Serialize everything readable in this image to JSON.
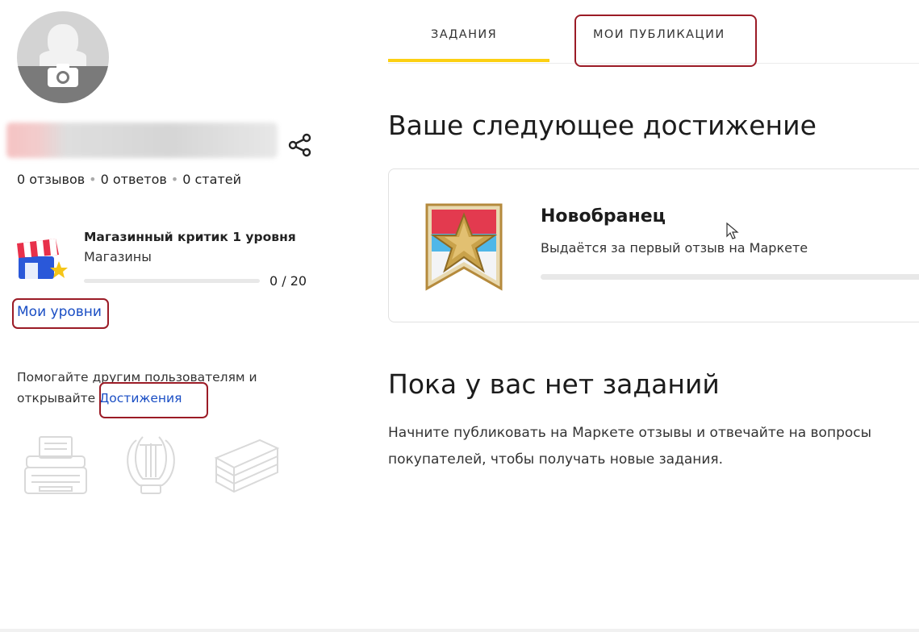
{
  "profile": {
    "stats": {
      "reviews": "0 отзывов",
      "answers": "0 ответов",
      "articles": "0 статей",
      "separator": "•"
    }
  },
  "level": {
    "title": "Магазинный критик 1 уровня",
    "category": "Магазины",
    "progress": 0,
    "progress_text": "0 / 20"
  },
  "links": {
    "my_levels": "Мои уровни"
  },
  "help": {
    "text": "Помогайте другим пользователям и открывайте",
    "achievements_link": "Достижения"
  },
  "tabs": [
    {
      "label": "ЗАДАНИЯ",
      "active": true
    },
    {
      "label": "МОИ ПУБЛИКАЦИИ",
      "active": false
    }
  ],
  "next_achievement": {
    "heading": "Ваше следующее достижение",
    "title": "Новобранец",
    "description": "Выдаётся за первый отзыв на Маркете",
    "progress": 0
  },
  "tasks": {
    "heading": "Пока у вас нет заданий",
    "body": "Начните публиковать на Маркете отзывы и отвечайте на вопросы покупателей, чтобы получать новые задания."
  },
  "colors": {
    "accent_yellow": "#fcd013",
    "link_blue": "#1a4ec4",
    "highlight_red": "#9b1b26"
  },
  "icons": {
    "avatar_camera": "camera-icon",
    "share": "share-icon",
    "level": "shop-critic-icon",
    "achievements": [
      "typewriter-icon",
      "lyre-icon",
      "books-icon"
    ],
    "badge": "star-ribbon-badge-icon"
  }
}
